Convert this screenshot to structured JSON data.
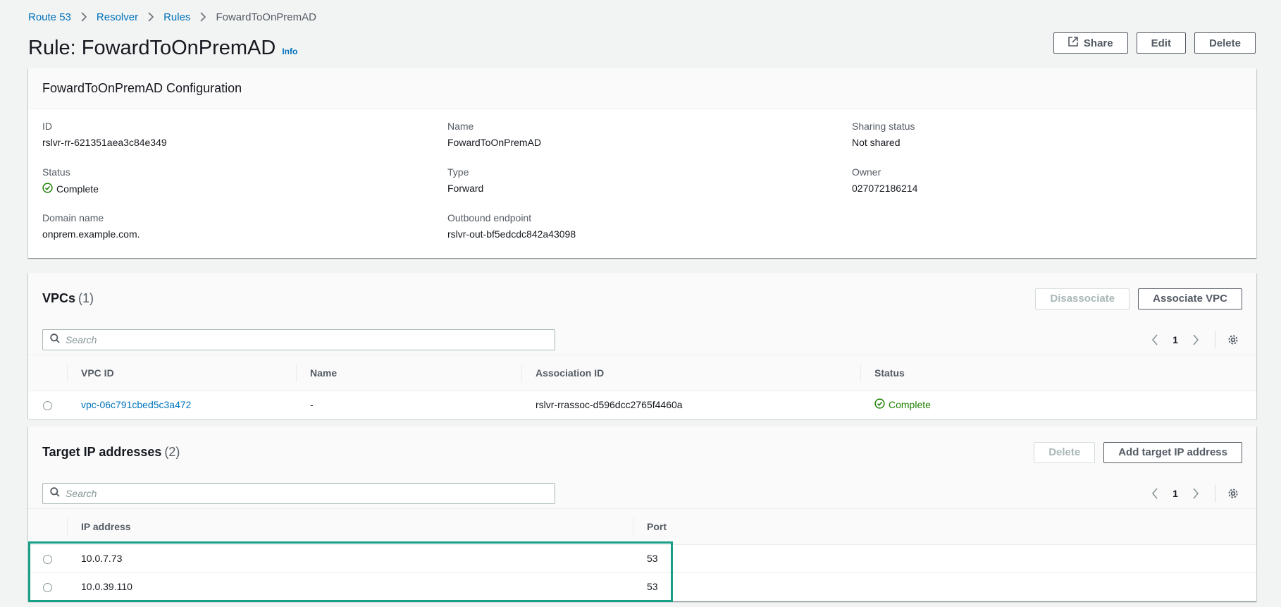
{
  "breadcrumb": {
    "items": [
      "Route 53",
      "Resolver",
      "Rules",
      "FowardToOnPremAD"
    ]
  },
  "title": {
    "text": "Rule: FowardToOnPremAD",
    "info": "Info"
  },
  "actions": {
    "share": "Share",
    "edit": "Edit",
    "delete": "Delete"
  },
  "config": {
    "heading": "FowardToOnPremAD Configuration",
    "id_label": "ID",
    "id_value": "rslvr-rr-621351aea3c84e349",
    "name_label": "Name",
    "name_value": "FowardToOnPremAD",
    "sharing_label": "Sharing status",
    "sharing_value": "Not shared",
    "status_label": "Status",
    "status_value": "Complete",
    "type_label": "Type",
    "type_value": "Forward",
    "owner_label": "Owner",
    "owner_value": "027072186214",
    "domain_label": "Domain name",
    "domain_value": "onprem.example.com.",
    "outbound_label": "Outbound endpoint",
    "outbound_value": "rslvr-out-bf5edcdc842a43098"
  },
  "vpcs": {
    "title": "VPCs",
    "count": "(1)",
    "disassociate": "Disassociate",
    "associate": "Associate VPC",
    "search_placeholder": "Search",
    "page": "1",
    "columns": [
      "VPC ID",
      "Name",
      "Association ID",
      "Status"
    ],
    "rows": [
      {
        "vpc_id": "vpc-06c791cbed5c3a472",
        "name": "-",
        "association_id": "rslvr-rrassoc-d596dcc2765f4460a",
        "status": "Complete"
      }
    ]
  },
  "targets": {
    "title": "Target IP addresses",
    "count": "(2)",
    "delete": "Delete",
    "add": "Add target IP address",
    "search_placeholder": "Search",
    "page": "1",
    "columns": [
      "IP address",
      "Port"
    ],
    "rows": [
      {
        "ip": "10.0.7.73",
        "port": "53"
      },
      {
        "ip": "10.0.39.110",
        "port": "53"
      }
    ]
  },
  "colors": {
    "link": "#0073bb",
    "success": "#1d8102",
    "highlight": "#17a086"
  }
}
